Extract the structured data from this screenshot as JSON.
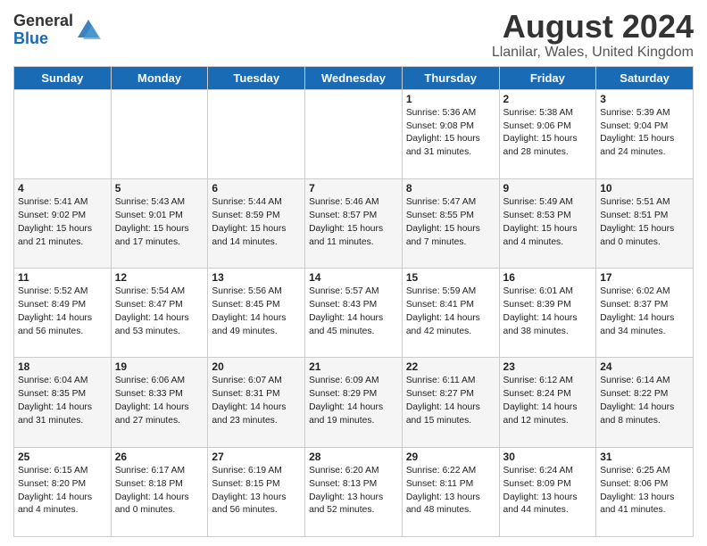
{
  "header": {
    "logo_line1": "General",
    "logo_line2": "Blue",
    "month": "August 2024",
    "location": "Llanilar, Wales, United Kingdom"
  },
  "weekdays": [
    "Sunday",
    "Monday",
    "Tuesday",
    "Wednesday",
    "Thursday",
    "Friday",
    "Saturday"
  ],
  "weeks": [
    [
      {
        "day": "",
        "sunrise": "",
        "sunset": "",
        "daylight": ""
      },
      {
        "day": "",
        "sunrise": "",
        "sunset": "",
        "daylight": ""
      },
      {
        "day": "",
        "sunrise": "",
        "sunset": "",
        "daylight": ""
      },
      {
        "day": "",
        "sunrise": "",
        "sunset": "",
        "daylight": ""
      },
      {
        "day": "1",
        "sunrise": "Sunrise: 5:36 AM",
        "sunset": "Sunset: 9:08 PM",
        "daylight": "Daylight: 15 hours and 31 minutes."
      },
      {
        "day": "2",
        "sunrise": "Sunrise: 5:38 AM",
        "sunset": "Sunset: 9:06 PM",
        "daylight": "Daylight: 15 hours and 28 minutes."
      },
      {
        "day": "3",
        "sunrise": "Sunrise: 5:39 AM",
        "sunset": "Sunset: 9:04 PM",
        "daylight": "Daylight: 15 hours and 24 minutes."
      }
    ],
    [
      {
        "day": "4",
        "sunrise": "Sunrise: 5:41 AM",
        "sunset": "Sunset: 9:02 PM",
        "daylight": "Daylight: 15 hours and 21 minutes."
      },
      {
        "day": "5",
        "sunrise": "Sunrise: 5:43 AM",
        "sunset": "Sunset: 9:01 PM",
        "daylight": "Daylight: 15 hours and 17 minutes."
      },
      {
        "day": "6",
        "sunrise": "Sunrise: 5:44 AM",
        "sunset": "Sunset: 8:59 PM",
        "daylight": "Daylight: 15 hours and 14 minutes."
      },
      {
        "day": "7",
        "sunrise": "Sunrise: 5:46 AM",
        "sunset": "Sunset: 8:57 PM",
        "daylight": "Daylight: 15 hours and 11 minutes."
      },
      {
        "day": "8",
        "sunrise": "Sunrise: 5:47 AM",
        "sunset": "Sunset: 8:55 PM",
        "daylight": "Daylight: 15 hours and 7 minutes."
      },
      {
        "day": "9",
        "sunrise": "Sunrise: 5:49 AM",
        "sunset": "Sunset: 8:53 PM",
        "daylight": "Daylight: 15 hours and 4 minutes."
      },
      {
        "day": "10",
        "sunrise": "Sunrise: 5:51 AM",
        "sunset": "Sunset: 8:51 PM",
        "daylight": "Daylight: 15 hours and 0 minutes."
      }
    ],
    [
      {
        "day": "11",
        "sunrise": "Sunrise: 5:52 AM",
        "sunset": "Sunset: 8:49 PM",
        "daylight": "Daylight: 14 hours and 56 minutes."
      },
      {
        "day": "12",
        "sunrise": "Sunrise: 5:54 AM",
        "sunset": "Sunset: 8:47 PM",
        "daylight": "Daylight: 14 hours and 53 minutes."
      },
      {
        "day": "13",
        "sunrise": "Sunrise: 5:56 AM",
        "sunset": "Sunset: 8:45 PM",
        "daylight": "Daylight: 14 hours and 49 minutes."
      },
      {
        "day": "14",
        "sunrise": "Sunrise: 5:57 AM",
        "sunset": "Sunset: 8:43 PM",
        "daylight": "Daylight: 14 hours and 45 minutes."
      },
      {
        "day": "15",
        "sunrise": "Sunrise: 5:59 AM",
        "sunset": "Sunset: 8:41 PM",
        "daylight": "Daylight: 14 hours and 42 minutes."
      },
      {
        "day": "16",
        "sunrise": "Sunrise: 6:01 AM",
        "sunset": "Sunset: 8:39 PM",
        "daylight": "Daylight: 14 hours and 38 minutes."
      },
      {
        "day": "17",
        "sunrise": "Sunrise: 6:02 AM",
        "sunset": "Sunset: 8:37 PM",
        "daylight": "Daylight: 14 hours and 34 minutes."
      }
    ],
    [
      {
        "day": "18",
        "sunrise": "Sunrise: 6:04 AM",
        "sunset": "Sunset: 8:35 PM",
        "daylight": "Daylight: 14 hours and 31 minutes."
      },
      {
        "day": "19",
        "sunrise": "Sunrise: 6:06 AM",
        "sunset": "Sunset: 8:33 PM",
        "daylight": "Daylight: 14 hours and 27 minutes."
      },
      {
        "day": "20",
        "sunrise": "Sunrise: 6:07 AM",
        "sunset": "Sunset: 8:31 PM",
        "daylight": "Daylight: 14 hours and 23 minutes."
      },
      {
        "day": "21",
        "sunrise": "Sunrise: 6:09 AM",
        "sunset": "Sunset: 8:29 PM",
        "daylight": "Daylight: 14 hours and 19 minutes."
      },
      {
        "day": "22",
        "sunrise": "Sunrise: 6:11 AM",
        "sunset": "Sunset: 8:27 PM",
        "daylight": "Daylight: 14 hours and 15 minutes."
      },
      {
        "day": "23",
        "sunrise": "Sunrise: 6:12 AM",
        "sunset": "Sunset: 8:24 PM",
        "daylight": "Daylight: 14 hours and 12 minutes."
      },
      {
        "day": "24",
        "sunrise": "Sunrise: 6:14 AM",
        "sunset": "Sunset: 8:22 PM",
        "daylight": "Daylight: 14 hours and 8 minutes."
      }
    ],
    [
      {
        "day": "25",
        "sunrise": "Sunrise: 6:15 AM",
        "sunset": "Sunset: 8:20 PM",
        "daylight": "Daylight: 14 hours and 4 minutes."
      },
      {
        "day": "26",
        "sunrise": "Sunrise: 6:17 AM",
        "sunset": "Sunset: 8:18 PM",
        "daylight": "Daylight: 14 hours and 0 minutes."
      },
      {
        "day": "27",
        "sunrise": "Sunrise: 6:19 AM",
        "sunset": "Sunset: 8:15 PM",
        "daylight": "Daylight: 13 hours and 56 minutes."
      },
      {
        "day": "28",
        "sunrise": "Sunrise: 6:20 AM",
        "sunset": "Sunset: 8:13 PM",
        "daylight": "Daylight: 13 hours and 52 minutes."
      },
      {
        "day": "29",
        "sunrise": "Sunrise: 6:22 AM",
        "sunset": "Sunset: 8:11 PM",
        "daylight": "Daylight: 13 hours and 48 minutes."
      },
      {
        "day": "30",
        "sunrise": "Sunrise: 6:24 AM",
        "sunset": "Sunset: 8:09 PM",
        "daylight": "Daylight: 13 hours and 44 minutes."
      },
      {
        "day": "31",
        "sunrise": "Sunrise: 6:25 AM",
        "sunset": "Sunset: 8:06 PM",
        "daylight": "Daylight: 13 hours and 41 minutes."
      }
    ]
  ]
}
